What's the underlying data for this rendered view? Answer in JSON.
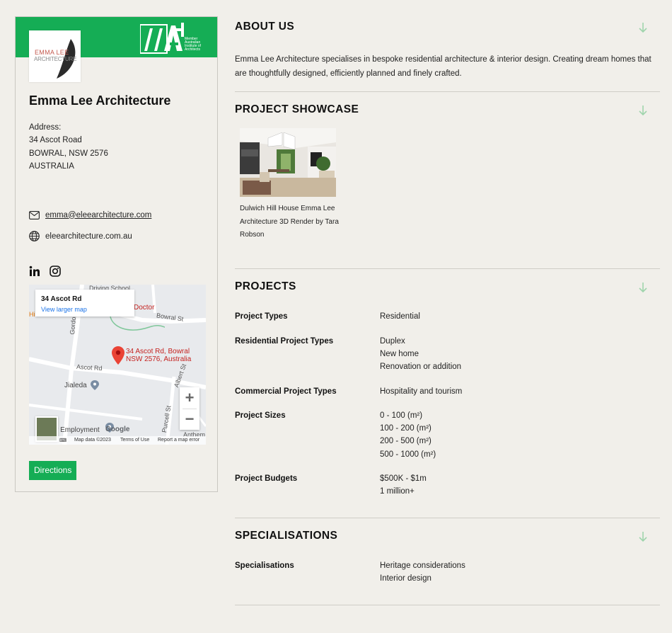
{
  "card": {
    "member_badge": {
      "text": "Member Australian Institute of Architects"
    },
    "logo": {
      "line1": "EMMA LEE",
      "line2": "ARCHITECTURE"
    },
    "firm_name": "Emma Lee Architecture",
    "address_label": "Address:",
    "address_line1": "34 Ascot Road",
    "address_line2": "BOWRAL, NSW 2576",
    "address_line3": "AUSTRALIA",
    "email": "emma@eleearchitecture.com",
    "website": "eleearchitecture.com.au",
    "social": [
      {
        "icon": "linkedin-icon"
      },
      {
        "icon": "instagram-icon"
      }
    ],
    "map": {
      "info_title": "34 Ascot Rd",
      "info_link": "View larger map",
      "pin_label_1": "34 Ascot Rd, Bowral",
      "pin_label_2": "NSW 2576, Australia",
      "labels": [
        "Driving School",
        "Doctor",
        "Bowral St",
        "Gordon Rd",
        "Ascot Rd",
        "Jialeda",
        "Albert St",
        "Purcell St",
        "Anthem",
        "r Employment",
        "Hi"
      ],
      "zoom_in": "+",
      "zoom_out": "−",
      "google": "Google",
      "footer_data": "Map data ©2023",
      "footer_terms": "Terms of Use",
      "footer_report": "Report a map error"
    },
    "directions_label": "Directions"
  },
  "about": {
    "title": "ABOUT US",
    "text": "Emma Lee Architecture specialises in bespoke residential architecture & interior design. Creating dream homes that are thoughtfully designed, efficiently planned and finely crafted."
  },
  "showcase": {
    "title": "PROJECT SHOWCASE",
    "caption": "Dulwich Hill House Emma Lee Architecture 3D Render by Tara Robson"
  },
  "projects": {
    "title": "PROJECTS",
    "rows": [
      {
        "label": "Project Types",
        "values": [
          "Residential"
        ]
      },
      {
        "label": "Residential Project Types",
        "values": [
          "Duplex",
          "New home",
          "Renovation or addition"
        ]
      },
      {
        "label": "Commercial Project Types",
        "values": [
          "Hospitality and tourism"
        ]
      },
      {
        "label": "Project Sizes",
        "values": [
          "0 - 100 (m²)",
          "100 - 200 (m²)",
          "200 - 500 (m²)",
          "500 - 1000 (m²)"
        ]
      },
      {
        "label": "Project Budgets",
        "values": [
          "$500K - $1m",
          "1 million+"
        ]
      }
    ]
  },
  "specialisations": {
    "title": "SPECIALISATIONS",
    "rows": [
      {
        "label": "Specialisations",
        "values": [
          "Heritage considerations",
          "Interior design"
        ]
      }
    ]
  },
  "colors": {
    "accent": "#15ad55",
    "arrow": "#9fd4ac",
    "background": "#f1efea"
  }
}
